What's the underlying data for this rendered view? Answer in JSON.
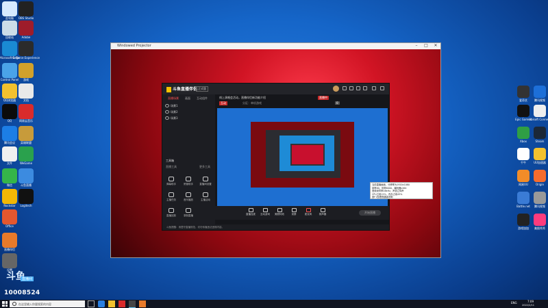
{
  "desktop": {
    "left_icons": [
      {
        "label": "此电脑",
        "color": "#d6eaff"
      },
      {
        "label": "OBS Studio",
        "color": "#222"
      },
      {
        "label": "回收站",
        "color": "#ccdde8"
      },
      {
        "label": "Adobe",
        "color": "#9e1c2a"
      },
      {
        "label": "Microsoft Edge",
        "color": "#1a8ad4"
      },
      {
        "label": "GeForce Experience",
        "color": "#2b2b2b"
      },
      {
        "label": "Control Panel",
        "color": "#4aa3e8"
      },
      {
        "label": "游戏",
        "color": "#d1a12b"
      },
      {
        "label": "QQ浏览器",
        "color": "#f2c12e"
      },
      {
        "label": "文档",
        "color": "#e9e9e9"
      },
      {
        "label": "QQ",
        "color": "#0b0b0b"
      },
      {
        "label": "网易云音乐",
        "color": "#d92b2b"
      },
      {
        "label": "腾讯会议",
        "color": "#1c7ee6"
      },
      {
        "label": "英雄联盟",
        "color": "#c79b3b"
      },
      {
        "label": "文件",
        "color": "#f0f0f0"
      },
      {
        "label": "WeGame",
        "color": "#2aa14d"
      },
      {
        "label": "微信",
        "color": "#35b54a"
      },
      {
        "label": "斗鱼直播",
        "color": "#3c8be0"
      },
      {
        "label": "Rockstar",
        "color": "#f2b705"
      },
      {
        "label": "Logitech",
        "color": "#111"
      },
      {
        "label": "Office",
        "color": "#e4572e"
      },
      {
        "label": "直播伴侣",
        "color": "#e87a2a"
      },
      {
        "label": "设置",
        "color": "#666"
      }
    ],
    "right_icons": [
      {
        "label": "爱奇艺",
        "color": "#333"
      },
      {
        "label": "腾讯视频",
        "color": "#1d6fd8"
      },
      {
        "label": "Epic Games",
        "color": "#111"
      },
      {
        "label": "Ubisoft Connect",
        "color": "#eee"
      },
      {
        "label": "Xbox",
        "color": "#2f9e44"
      },
      {
        "label": "Steam",
        "color": "#1b2838"
      },
      {
        "label": "千牛",
        "color": "#ffffff"
      },
      {
        "label": "UU加速器",
        "color": "#f2c12e"
      },
      {
        "label": "网易UU",
        "color": "#f28c28"
      },
      {
        "label": "Origin",
        "color": "#f56c2d"
      },
      {
        "label": "Battle.net",
        "color": "#3a7bd5"
      },
      {
        "label": "腾讯视频",
        "color": "#999"
      },
      {
        "label": "游戏加加",
        "color": "#222"
      },
      {
        "label": "美图秀秀",
        "color": "#ff3b7d"
      }
    ]
  },
  "window": {
    "title": "Windowed Projector"
  },
  "app": {
    "logo_text": "斗鱼直播伴侣",
    "beta_label": "正式版",
    "tabs": [
      "直播场景",
      "画面",
      "互动组件"
    ],
    "scenes": [
      "场景1",
      "场景2",
      "场景3"
    ],
    "tools_header": "工具箱",
    "tools_sub_left": "直播工具",
    "tools_sub_right": "更多工具",
    "tools": [
      "弹幕助手",
      "房管助手",
      "直播间设置",
      "主播任务",
      "音乐播放",
      "主播活动",
      "直播回放",
      "录制直播"
    ],
    "room_title": "线上演唱会活动，直播伴侣新功能介绍",
    "room_tag": "互动",
    "category": "分区：单机游戏",
    "badges": [
      {
        "text": "直播中",
        "color": "#c62828"
      },
      {
        "text": "0",
        "color": "#555"
      }
    ],
    "bottom_tools": [
      "直播连麦",
      "互动游戏",
      "美颜特效",
      "录屏",
      "麦克风",
      "扬声器"
    ],
    "go_live_label": "开始直播",
    "footer_notice": "斗鱼提醒：请遵守直播规范，切勿传播违法违规内容。"
  },
  "tooltip": {
    "lines": [
      "当前直播画面，分辨率为1920x1080",
      "帧率60，码率6000，编码器x264",
      "音频采样率48kHz，声道立体声",
      "CPU占用12%，内存占用45%",
      "按F1查看快捷键说明"
    ]
  },
  "overlay": {
    "brand": "斗鱼",
    "sub": "直播间",
    "room_number": "10008524"
  },
  "taskbar": {
    "search_placeholder": "在这里输入你要搜索的内容",
    "tray_lang": "ENG",
    "time": "7:09",
    "date": "2022/2/11"
  }
}
